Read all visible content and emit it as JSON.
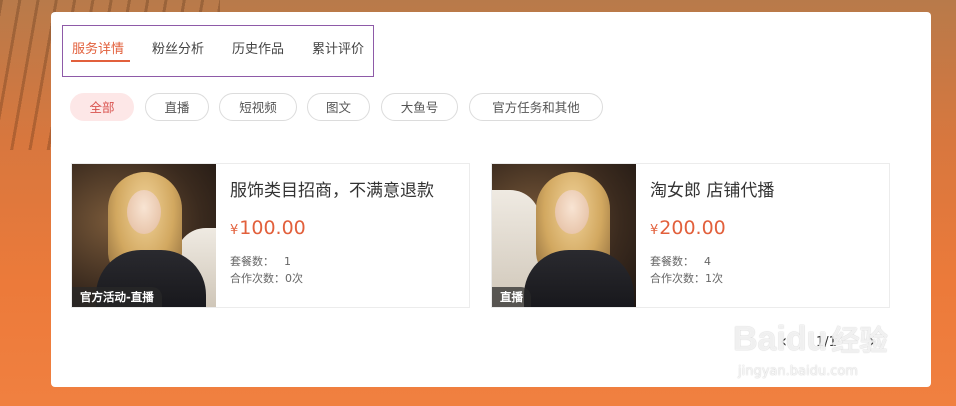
{
  "tabs": [
    {
      "label": "服务详情",
      "active": true
    },
    {
      "label": "粉丝分析",
      "active": false
    },
    {
      "label": "历史作品",
      "active": false
    },
    {
      "label": "累计评价",
      "active": false
    }
  ],
  "filters": [
    {
      "label": "全部",
      "active": true
    },
    {
      "label": "直播",
      "active": false
    },
    {
      "label": "短视频",
      "active": false
    },
    {
      "label": "图文",
      "active": false
    },
    {
      "label": "大鱼号",
      "active": false
    },
    {
      "label": "官方任务和其他",
      "active": false
    }
  ],
  "services": [
    {
      "badge": "官方活动-直播",
      "title": "服饰类目招商，不满意退款",
      "currency": "¥",
      "price": "100.00",
      "package_count_label": "套餐数：",
      "package_count": "1",
      "coop_label": "合作次数：",
      "coop_count": "0次"
    },
    {
      "badge": "直播",
      "title": "淘女郎 店铺代播",
      "currency": "¥",
      "price": "200.00",
      "package_count_label": "套餐数：",
      "package_count": "4",
      "coop_label": "合作次数：",
      "coop_count": "1次"
    }
  ],
  "pagination": {
    "prev": "‹",
    "current": "1/1",
    "next": "›"
  },
  "watermark": {
    "logo": "Baidu",
    "logo_suffix": "经验",
    "url": "jingyan.baidu.com"
  },
  "colors": {
    "accent": "#e2603c",
    "active_filter_bg": "#fde7e7",
    "tab_box_border": "#8e5aa8"
  }
}
